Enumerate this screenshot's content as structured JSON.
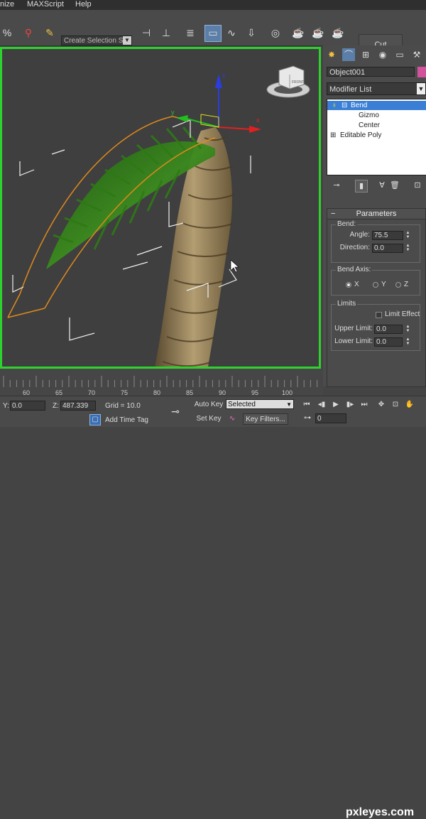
{
  "menu": {
    "items": [
      "nize",
      "MAXScript",
      "Help"
    ]
  },
  "toolbar": {
    "selection_set_placeholder": "Create Selection Se",
    "cut_label": "Cut",
    "icons": [
      "percent-snap-icon",
      "spinner-snap-icon",
      "edit-named-selection-icon",
      "named-selection-sets-dropdown",
      "mirror-icon",
      "align-icon",
      "layer-manager-icon",
      "ribbon-icon",
      "curve-editor-icon",
      "schematic-view-icon",
      "material-editor-icon",
      "render-setup-icon",
      "render-frame-icon",
      "render-icon"
    ]
  },
  "viewport": {
    "gizmo_labels": {
      "x": "x",
      "y": "y",
      "z": "z"
    },
    "viewcube_label": "FRONT"
  },
  "command_panel": {
    "object_name": "Object001",
    "object_color": "#d2529c",
    "modifier_list_label": "Modifier List",
    "stack": [
      {
        "label": "Bend",
        "level": 0,
        "selected": true
      },
      {
        "label": "Gizmo",
        "level": 1,
        "selected": false
      },
      {
        "label": "Center",
        "level": 1,
        "selected": false
      },
      {
        "label": "Editable Poly",
        "level": 0,
        "selected": false
      }
    ],
    "parameters": {
      "header": "Parameters",
      "bend_group": "Bend:",
      "angle_label": "Angle:",
      "angle_value": "75.5",
      "direction_label": "Direction:",
      "direction_value": "0.0",
      "axis_group": "Bend Axis:",
      "axis_options": [
        "X",
        "Y",
        "Z"
      ],
      "axis_selected": "X",
      "limits_group": "Limits",
      "limit_effect_label": "Limit Effect",
      "limit_effect_checked": false,
      "upper_limit_label": "Upper Limit:",
      "upper_limit_value": "0.0",
      "lower_limit_label": "Lower Limit:",
      "lower_limit_value": "0.0"
    }
  },
  "timeline": {
    "ticks": [
      "60",
      "65",
      "70",
      "75",
      "80",
      "85",
      "90",
      "95",
      "100"
    ]
  },
  "statusbar": {
    "y_label": "Y:",
    "y_value": "0.0",
    "z_label": "Z:",
    "z_value": "487.339",
    "grid_label": "Grid = 10.0",
    "add_time_tag": "Add Time Tag",
    "auto_key": "Auto Key",
    "auto_key_value": "Selected",
    "set_key": "Set Key",
    "key_filters": "Key Filters...",
    "frame_value": "0",
    "watermark": "pxleyes.com"
  }
}
